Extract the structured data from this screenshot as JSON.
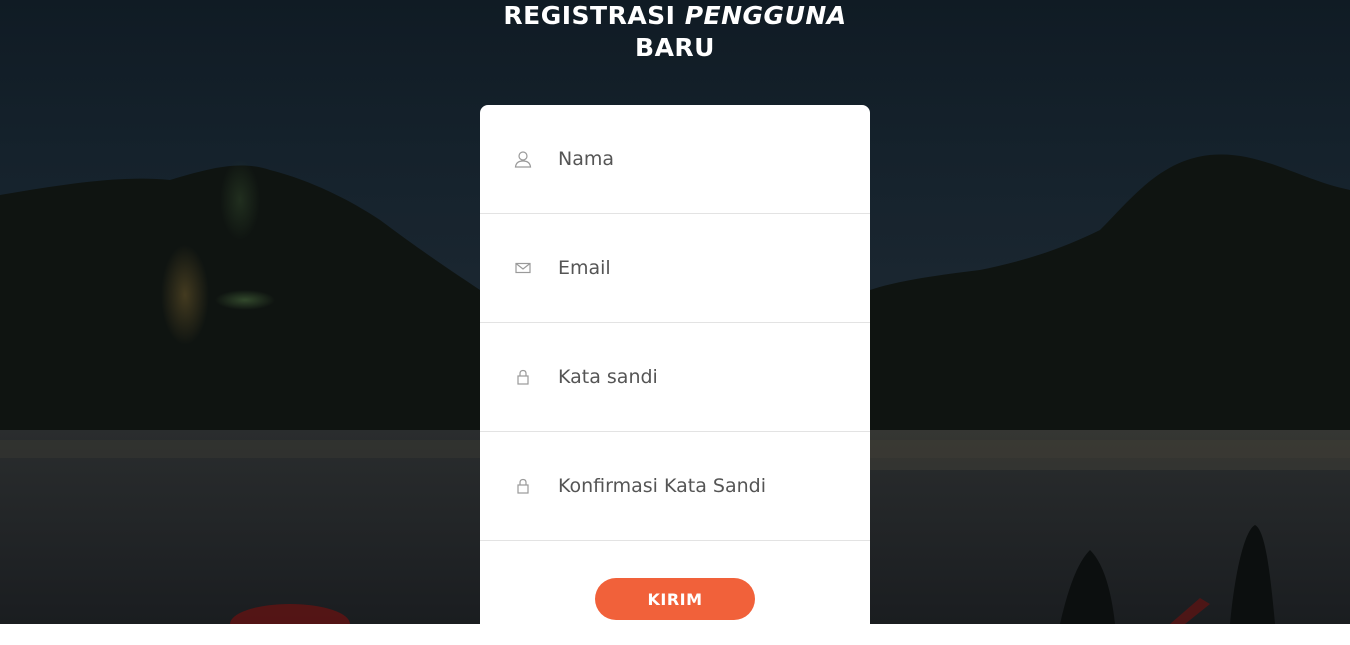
{
  "header": {
    "title_part1": "REGISTRASI",
    "title_part2": "PENGGUNA",
    "title_part3": "BARU"
  },
  "form": {
    "fields": [
      {
        "icon": "user-icon",
        "placeholder": "Nama",
        "value": ""
      },
      {
        "icon": "mail-icon",
        "placeholder": "Email",
        "value": ""
      },
      {
        "icon": "lock-icon",
        "placeholder": "Kata sandi",
        "value": ""
      },
      {
        "icon": "lock-icon",
        "placeholder": "Konfirmasi Kata Sandi",
        "value": ""
      }
    ],
    "submit_label": "KIRIM"
  },
  "colors": {
    "accent": "#f1613a",
    "card_bg": "#ffffff",
    "icon": "#9a9a9a"
  }
}
